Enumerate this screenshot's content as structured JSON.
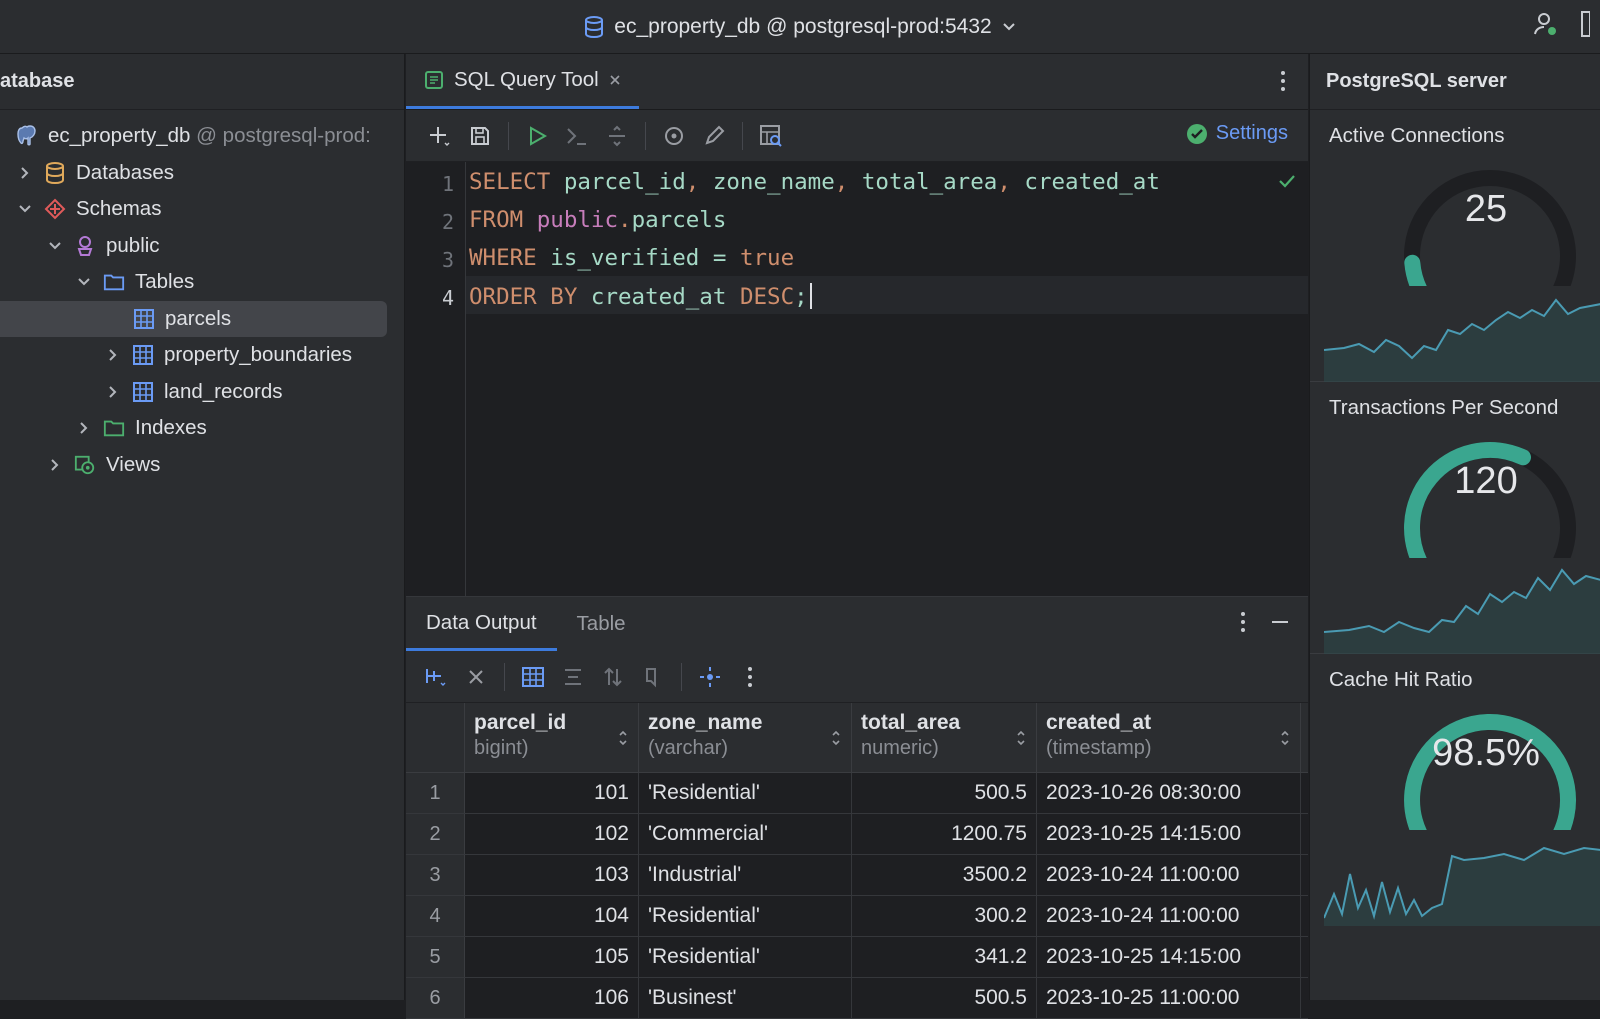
{
  "titlebar": {
    "connection": "ec_property_db @ postgresql-prod:5432"
  },
  "sidebar": {
    "header": "atabase",
    "tree": [
      {
        "label": "ec_property_db",
        "suffix": "@ postgresql-prod:",
        "icon": "postgres-elephant-icon",
        "level": 0
      },
      {
        "label": "Databases",
        "icon": "database-icon",
        "level": 1
      },
      {
        "label": "Schemas",
        "icon": "schemas-icon",
        "level": 1
      },
      {
        "label": "public",
        "icon": "schema-icon",
        "level": 2
      },
      {
        "label": "Tables",
        "icon": "folder-icon",
        "level": 3
      },
      {
        "label": "parcels",
        "icon": "table-icon",
        "level": 4
      },
      {
        "label": "property_boundaries",
        "icon": "table-icon",
        "level": 4
      },
      {
        "label": "land_records",
        "icon": "table-icon",
        "level": 4
      },
      {
        "label": "Indexes",
        "icon": "folder-icon",
        "level": 3
      },
      {
        "label": "Views",
        "icon": "views-icon",
        "level": 2
      }
    ]
  },
  "editor": {
    "tab_label": "SQL Query Tool",
    "settings_label": "Settings",
    "line_numbers": [
      "1",
      "2",
      "3",
      "4"
    ],
    "lines": [
      [
        {
          "t": "SELECT",
          "c": "kw"
        },
        {
          "t": " "
        },
        {
          "t": "parcel_id",
          "c": "id"
        },
        {
          "t": ", ",
          "c": "kw"
        },
        {
          "t": "zone_name",
          "c": "id"
        },
        {
          "t": ", ",
          "c": "kw"
        },
        {
          "t": "total_area",
          "c": "id"
        },
        {
          "t": ", ",
          "c": "kw"
        },
        {
          "t": "created_at",
          "c": "id"
        }
      ],
      [
        {
          "t": "FROM",
          "c": "kw"
        },
        {
          "t": " "
        },
        {
          "t": "public",
          "c": "pu"
        },
        {
          "t": ".",
          "c": "kw"
        },
        {
          "t": "parcels",
          "c": "id"
        }
      ],
      [
        {
          "t": "WHERE",
          "c": "kw"
        },
        {
          "t": " "
        },
        {
          "t": "is_verified",
          "c": "id"
        },
        {
          "t": " = ",
          "c": "id"
        },
        {
          "t": "true",
          "c": "kw"
        }
      ],
      [
        {
          "t": "ORDER BY",
          "c": "kw"
        },
        {
          "t": " "
        },
        {
          "t": "created_at",
          "c": "id"
        },
        {
          "t": " "
        },
        {
          "t": "DESC",
          "c": "kw"
        },
        {
          "t": ";",
          "c": "id"
        }
      ]
    ]
  },
  "results": {
    "tabs": [
      "Data Output",
      "Table"
    ],
    "columns": [
      {
        "name": "parcel_id",
        "type": "bigint)"
      },
      {
        "name": "zone_name",
        "type": "(varchar)"
      },
      {
        "name": "total_area",
        "type": "numeric)"
      },
      {
        "name": "created_at",
        "type": "(timestamp)"
      }
    ],
    "rows": [
      [
        "1",
        "101",
        "'Residential'",
        "500.5",
        "2023-10-26 08:30:00"
      ],
      [
        "2",
        "102",
        "'Commercial'",
        "1200.75",
        "2023-10-25 14:15:00"
      ],
      [
        "3",
        "103",
        "'Industrial'",
        "3500.2",
        "2023-10-24 11:00:00"
      ],
      [
        "4",
        "104",
        "'Residential'",
        "300.2",
        "2023-10-24 11:00:00"
      ],
      [
        "5",
        "105",
        "'Residential'",
        "341.2",
        "2023-10-25 14:15:00"
      ],
      [
        "6",
        "106",
        "'Businest'",
        "500.5",
        "2023-10-25 11:00:00"
      ]
    ]
  },
  "server_panel": {
    "title": "PostgreSQL server",
    "metrics": [
      {
        "title": "Active Connections",
        "value": "25",
        "level": 0.12
      },
      {
        "title": "Transactions Per Second",
        "value": "120",
        "level": 0.6
      },
      {
        "title": "Cache Hit Ratio",
        "value": "98.5%",
        "level": 0.985
      }
    ]
  },
  "colors": {
    "accent": "#3d7bdd",
    "gauge_track": "#1e1f22",
    "gauge_fill": "#3aa68f",
    "success": "#4caf6e"
  }
}
